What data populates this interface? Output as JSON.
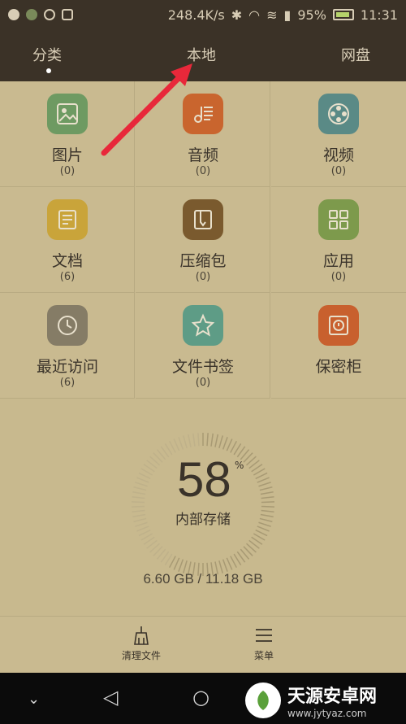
{
  "status": {
    "network_speed": "248.4K/s",
    "battery": "95%",
    "time": "11:31"
  },
  "tabs": [
    {
      "label": "分类"
    },
    {
      "label": "本地"
    },
    {
      "label": "网盘"
    }
  ],
  "categories": [
    {
      "label": "图片",
      "count": "(0)",
      "icon": "image-icon",
      "color": "#6e9a62"
    },
    {
      "label": "音频",
      "count": "(0)",
      "icon": "music-icon",
      "color": "#c9652e"
    },
    {
      "label": "视频",
      "count": "(0)",
      "icon": "film-reel-icon",
      "color": "#5a8a86"
    },
    {
      "label": "文档",
      "count": "(6)",
      "icon": "document-icon",
      "color": "#c9a43a"
    },
    {
      "label": "压缩包",
      "count": "(0)",
      "icon": "archive-icon",
      "color": "#7a5a2e"
    },
    {
      "label": "应用",
      "count": "(0)",
      "icon": "apps-grid-icon",
      "color": "#7d9a4c"
    },
    {
      "label": "最近访问",
      "count": "(6)",
      "icon": "clock-icon",
      "color": "#857c66"
    },
    {
      "label": "文件书签",
      "count": "(0)",
      "icon": "star-icon",
      "color": "#5e9c86"
    },
    {
      "label": "保密柜",
      "count": "",
      "icon": "safe-icon",
      "color": "#c8602e"
    }
  ],
  "storage": {
    "percent": "58",
    "percent_sign": "%",
    "label": "内部存储",
    "size": "6.60 GB / 11.18 GB",
    "used_fraction": 0.58
  },
  "bottom": {
    "clean_label": "清理文件",
    "menu_label": "菜单"
  },
  "watermark": {
    "main": "天源安卓网",
    "sub": "www.jytyaz.com"
  }
}
